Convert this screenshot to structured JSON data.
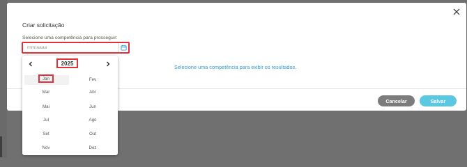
{
  "modal": {
    "title": "Criar solicitação",
    "field_label": "Selecione uma competência para prosseguir:",
    "date_placeholder": "mm/aaaa",
    "empty_message": "Selecione uma competência para exibir os resultados.",
    "cancel_label": "Cancelar",
    "save_label": "Salvar"
  },
  "picker": {
    "year": "2025",
    "selected_month": "Jan",
    "months": [
      "Jan",
      "Fev",
      "Mar",
      "Abr",
      "Mai",
      "Jun",
      "Jul",
      "Ago",
      "Set",
      "Out",
      "Nov",
      "Dez"
    ]
  },
  "colors": {
    "overlay": "#707070",
    "highlight_border": "#e0303a",
    "link_blue": "#2a9fd4",
    "cancel_button": "#7c7c7c",
    "save_button": "#5bc8e2"
  },
  "icons": [
    "close-icon",
    "calendar-icon",
    "chevron-left-icon",
    "chevron-right-icon"
  ]
}
